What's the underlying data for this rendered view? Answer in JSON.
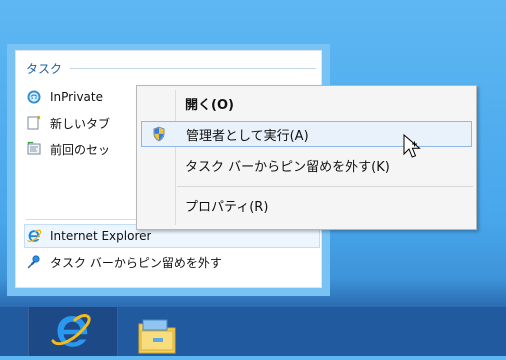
{
  "jumplist": {
    "section_header": "タスク",
    "items": [
      {
        "label": "InPrivate",
        "icon": "inprivate-icon"
      },
      {
        "label": "新しいタブ",
        "icon": "new-tab-icon"
      },
      {
        "label": "前回のセッ",
        "icon": "restore-session-icon"
      }
    ],
    "pinned_item": {
      "label": "Internet Explorer",
      "icon": "ie-icon"
    },
    "unpin_item": {
      "label": "タスク バーからピン留めを外す",
      "icon": "pin-icon"
    }
  },
  "context_menu": {
    "items": [
      {
        "label": "開く(O)",
        "bold": true,
        "icon": ""
      },
      {
        "label": "管理者として実行(A)",
        "icon": "uac-shield-icon",
        "highlighted": true
      },
      {
        "label": "タスク バーからピン留めを外す(K)",
        "icon": ""
      },
      {
        "label": "プロパティ(R)",
        "icon": ""
      }
    ]
  },
  "taskbar": {
    "items": [
      {
        "name": "Internet Explorer",
        "icon": "ie-icon"
      },
      {
        "name": "File Explorer",
        "icon": "folder-icon"
      }
    ]
  },
  "colors": {
    "accent": "#1f5fa0",
    "selection_fill": "#e9f2fb",
    "selection_border": "#91b9df",
    "desktop_top": "#5eb7f2",
    "taskbar": "#225aa0"
  }
}
